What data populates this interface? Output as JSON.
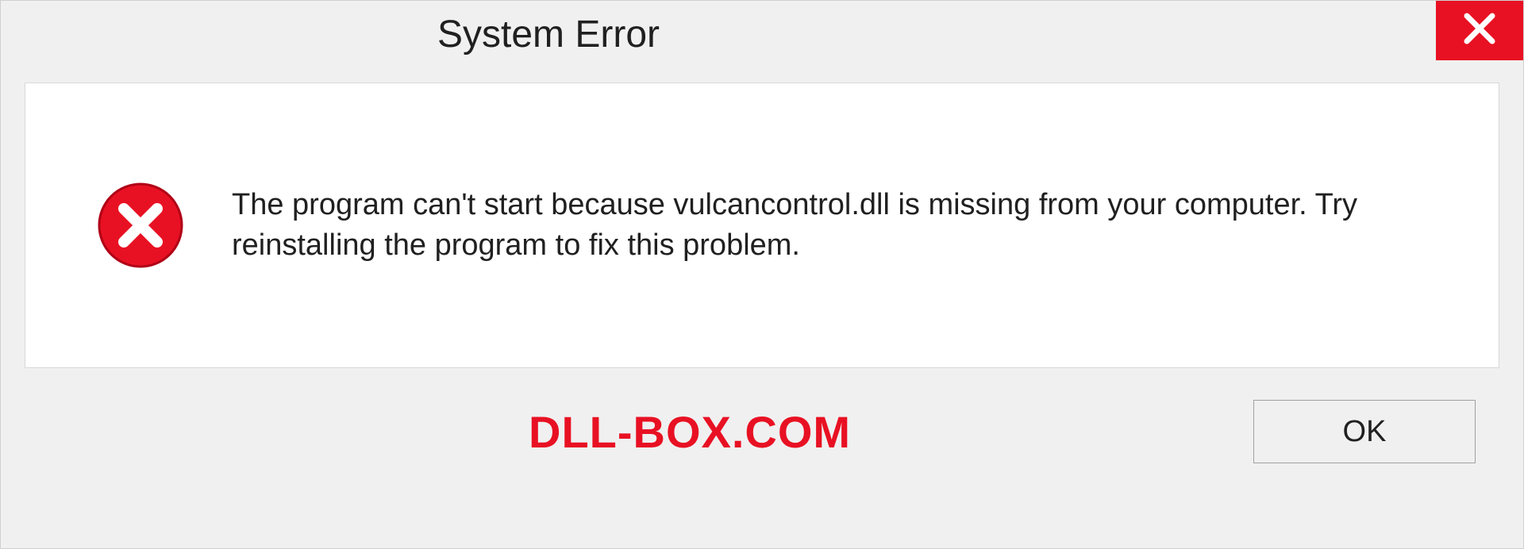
{
  "window": {
    "title": "System Error"
  },
  "dialog": {
    "message": "The program can't start because vulcancontrol.dll is missing from your computer. Try reinstalling the program to fix this problem."
  },
  "footer": {
    "watermark": "DLL-BOX.COM",
    "ok_label": "OK"
  },
  "colors": {
    "close_bg": "#e81123",
    "error_icon": "#e81123",
    "watermark_text": "#e81123"
  }
}
